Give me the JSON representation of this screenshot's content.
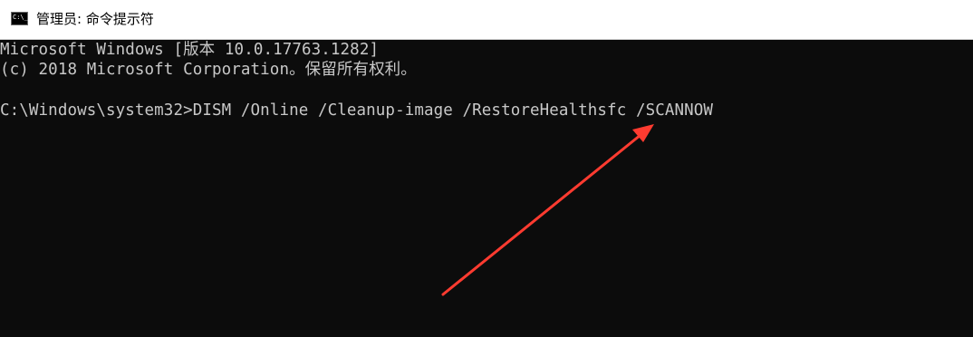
{
  "window": {
    "title": "管理员: 命令提示符",
    "icon_name": "cmd-icon",
    "icon_glyph": "C:\\_"
  },
  "console": {
    "lines": [
      "Microsoft Windows [版本 10.0.17763.1282]",
      "(c) 2018 Microsoft Corporation。保留所有权利。",
      "C:\\Windows\\system32>DISM /Online /Cleanup-image /RestoreHealthsfc /SCANNOW"
    ],
    "background_color": "#0c0c0c",
    "text_color": "#c8c8c8"
  },
  "annotation": {
    "arrow_color": "#ff3b30",
    "icon_name": "red-arrow-annotation"
  }
}
